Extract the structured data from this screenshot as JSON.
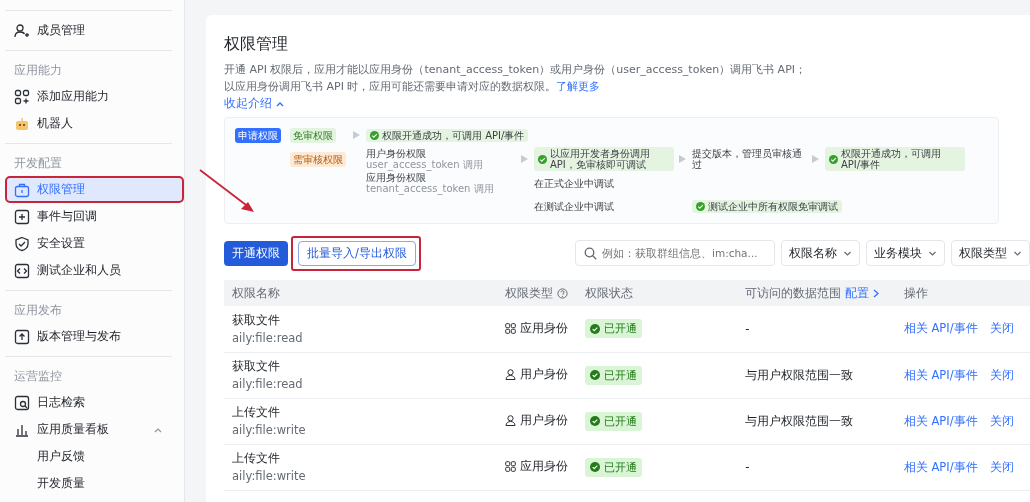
{
  "sidebar": {
    "groups": [
      {
        "items": [
          {
            "label": "成员管理",
            "selected": false,
            "highlighted": false
          }
        ]
      },
      {
        "title": "应用能力",
        "items": [
          {
            "label": "添加应用能力",
            "selected": false,
            "highlighted": false
          },
          {
            "label": "机器人",
            "selected": false,
            "highlighted": false
          }
        ]
      },
      {
        "title": "开发配置",
        "items": [
          {
            "label": "权限管理",
            "selected": true,
            "highlighted": true
          },
          {
            "label": "事件与回调",
            "selected": false,
            "highlighted": false
          },
          {
            "label": "安全设置",
            "selected": false,
            "highlighted": false
          },
          {
            "label": "测试企业和人员",
            "selected": false,
            "highlighted": false
          }
        ]
      },
      {
        "title": "应用发布",
        "items": [
          {
            "label": "版本管理与发布",
            "selected": false,
            "highlighted": false
          }
        ]
      },
      {
        "title": "运营监控",
        "items": [
          {
            "label": "日志检索",
            "selected": false,
            "highlighted": false
          },
          {
            "label": "应用质量看板",
            "selected": false,
            "highlighted": false,
            "expanded": true,
            "children": [
              {
                "label": "用户反馈",
                "selected": false,
                "highlighted": false
              },
              {
                "label": "开发质量",
                "selected": false,
                "highlighted": false
              }
            ]
          }
        ]
      }
    ]
  },
  "page": {
    "title": "权限管理",
    "description": "开通 API 权限后，应用才能以应用身份（tenant_access_token）或用户身份（user_access_token）调用飞书 API；以应用身份调用飞书 API 时，应用可能还需要申请对应的数据权限。",
    "learn_more": "了解更多",
    "collapse": {
      "label": "收起介绍",
      "expanded": true
    }
  },
  "intro_diagram": {
    "rows": [
      [
        {
          "kind": "tag-blue",
          "text": "申请权限"
        },
        {
          "kind": "tag-green",
          "text": "免审权限"
        },
        {
          "kind": "arrow"
        },
        {
          "kind": "success",
          "text": "权限开通成功，可调用 API/事件"
        }
      ],
      [
        "",
        {
          "kind": "tag-orange",
          "text": "需审核权限"
        },
        "",
        {
          "kind": "label",
          "text": "用户身份权限",
          "note": "user_access_token 调用"
        },
        {
          "kind": "arrow"
        },
        {
          "kind": "success",
          "text": "以应用开发者身份调用 API，免审核即可调试"
        },
        {
          "kind": "arrow"
        },
        {
          "kind": "text",
          "text": "提交版本，管理员审核通过"
        },
        {
          "kind": "arrow"
        },
        {
          "kind": "success",
          "text": "权限开通成功，可调用 API/事件"
        }
      ],
      [
        "",
        "",
        "",
        {
          "kind": "label",
          "text": "应用身份权限",
          "note": "tenant_access_token 调用"
        },
        "",
        {
          "kind": "text",
          "text": "在正式企业中调试"
        }
      ],
      [
        "",
        "",
        "",
        "",
        "",
        {
          "kind": "text",
          "text": "在测试企业中调试"
        },
        "",
        {
          "kind": "success",
          "text": "测试企业中所有权限免审调试"
        }
      ]
    ]
  },
  "toolbar": {
    "primary_button": "开通权限",
    "batch_button": {
      "label": "批量导入/导出权限",
      "highlighted": true
    },
    "search": {
      "placeholder": "例如：获取群组信息、im:cha..."
    },
    "filters": [
      "权限名称",
      "业务模块",
      "权限类型"
    ]
  },
  "table": {
    "columns": [
      {
        "label": "权限名称"
      },
      {
        "label": "权限类型",
        "help": true
      },
      {
        "label": "权限状态"
      },
      {
        "label": "可访问的数据范围",
        "link": "配置"
      },
      {
        "label": "操作"
      }
    ],
    "rows": [
      {
        "name": "获取文件",
        "scope": "aily:file:read",
        "identity": {
          "kind": "app",
          "label": "应用身份"
        },
        "status": "已开通",
        "data_range": "-",
        "actions": [
          "相关 API/事件",
          "关闭"
        ]
      },
      {
        "name": "获取文件",
        "scope": "aily:file:read",
        "identity": {
          "kind": "user",
          "label": "用户身份"
        },
        "status": "已开通",
        "data_range": "与用户权限范围一致",
        "actions": [
          "相关 API/事件",
          "关闭"
        ]
      },
      {
        "name": "上传文件",
        "scope": "aily:file:write",
        "identity": {
          "kind": "user",
          "label": "用户身份"
        },
        "status": "已开通",
        "data_range": "与用户权限范围一致",
        "actions": [
          "相关 API/事件",
          "关闭"
        ]
      },
      {
        "name": "上传文件",
        "scope": "aily:file:write",
        "identity": {
          "kind": "app",
          "label": "应用身份"
        },
        "status": "已开通",
        "data_range": "-",
        "actions": [
          "相关 API/事件",
          "关闭"
        ]
      }
    ]
  }
}
